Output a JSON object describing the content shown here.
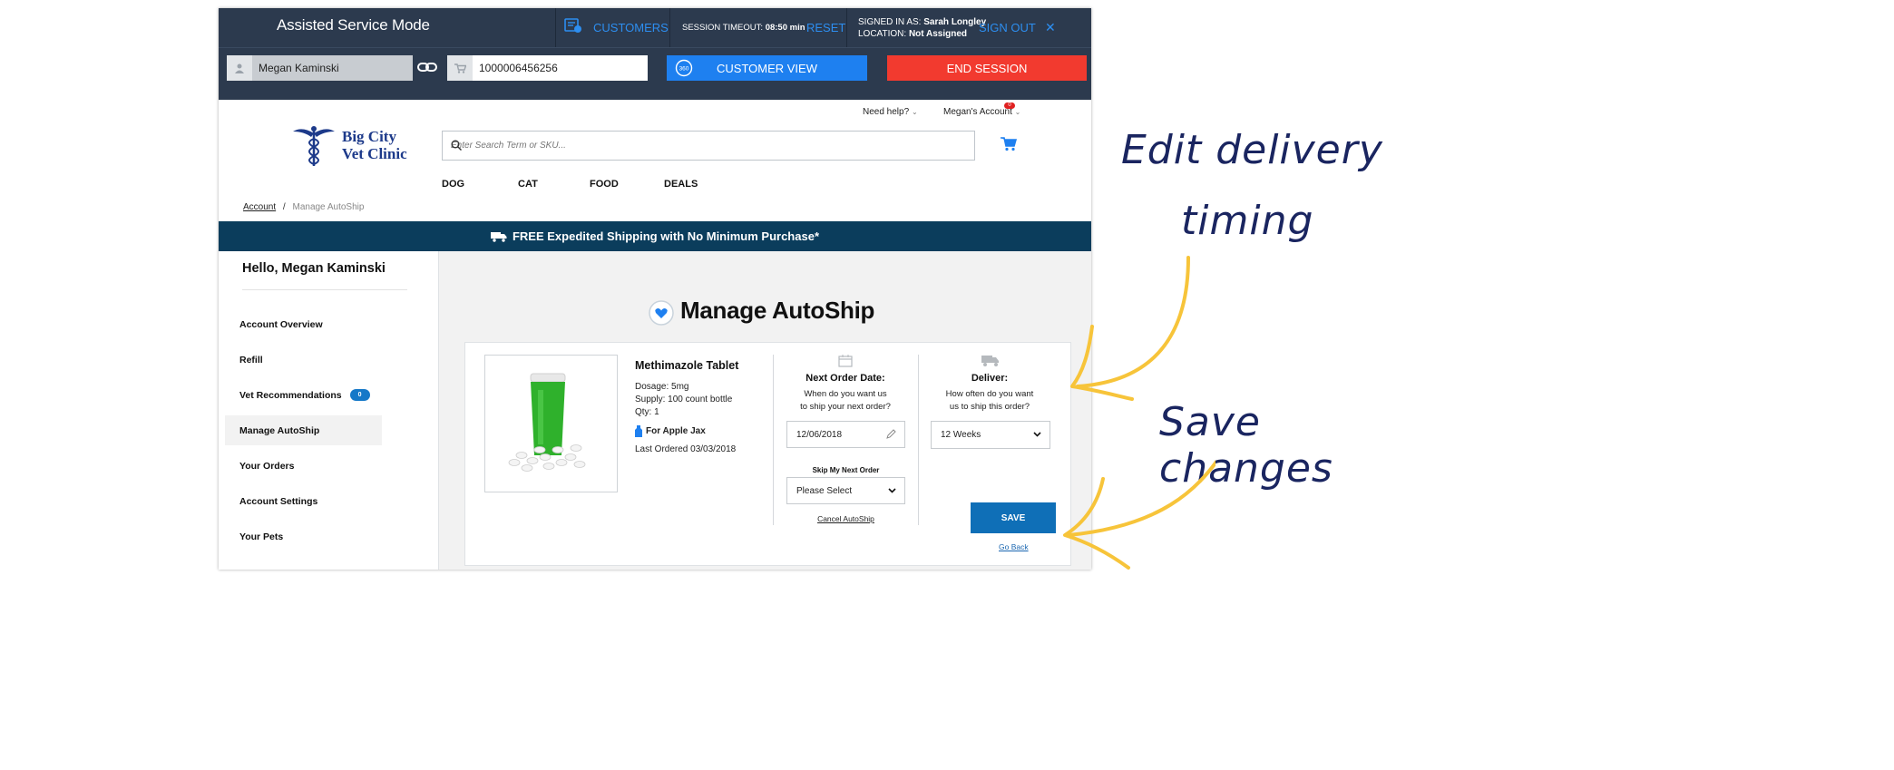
{
  "asm": {
    "title": "Assisted Service Mode",
    "customers_label": "CUSTOMERS",
    "session_timeout_label": "SESSION TIMEOUT:",
    "session_timeout_value": "08:50 min",
    "reset_label": "RESET",
    "signed_in_label": "SIGNED IN AS:",
    "signed_in_value": "Sarah Longley",
    "location_label": "LOCATION:",
    "location_value": "Not Assigned",
    "sign_out_label": "SIGN OUT",
    "close_glyph": "✕",
    "customer_name": "Megan Kaminski",
    "cart_id": "1000006456256",
    "customer_view_label": "CUSTOMER VIEW",
    "customer_view_icon_text": "360",
    "end_session_label": "END SESSION"
  },
  "header": {
    "need_help": "Need help?",
    "account_menu": "Megan's Account",
    "account_badge": "0",
    "logo_line1": "Big City",
    "logo_line2": "Vet Clinic",
    "search_placeholder": "Enter Search Term or SKU...",
    "nav": [
      "DOG",
      "CAT",
      "FOOD",
      "DEALS"
    ]
  },
  "breadcrumb": {
    "root": "Account",
    "separator": "/",
    "current": "Manage AutoShip"
  },
  "promo": {
    "text": "FREE Expedited Shipping with No Minimum Purchase*"
  },
  "sidebar": {
    "greeting": "Hello, Megan Kaminski",
    "items": [
      {
        "label": "Account Overview"
      },
      {
        "label": "Refill"
      },
      {
        "label": "Vet Recommendations",
        "badge": "0"
      },
      {
        "label": "Manage AutoShip"
      },
      {
        "label": "Your Orders"
      },
      {
        "label": "Account Settings"
      },
      {
        "label": "Your Pets"
      }
    ]
  },
  "autoship": {
    "title": "Manage AutoShip",
    "product": {
      "name": "Methimazole Tablet",
      "dosage": "Dosage: 5mg",
      "supply": "Supply:  100 count bottle",
      "qty": "Qty:  1",
      "pet": "For Apple Jax",
      "last_ordered": "Last Ordered 03/03/2018"
    },
    "next_order": {
      "title": "Next Order Date:",
      "question_line1": "When do you want us",
      "question_line2": "to ship your next order?",
      "date_value": "12/06/2018",
      "skip_label": "Skip My Next Order",
      "skip_value": "Please Select",
      "cancel_label": "Cancel AutoShip"
    },
    "deliver": {
      "title": "Deliver:",
      "question_line1": "How often do you want",
      "question_line2": "us to ship this order?",
      "frequency_value": "12 Weeks"
    },
    "save_label": "SAVE",
    "go_back_label": "Go Back"
  },
  "annotations": {
    "edit_line1": "Edit delivery",
    "edit_line2": "timing",
    "save_note": "Save changes",
    "arrow_color": "#f7c43a",
    "text_color": "#1a2560"
  },
  "colors": {
    "asm_bar": "#2c3a4e",
    "customer_view": "#1e80f0",
    "end_session": "#f23a2f",
    "promo_bar": "#0b3d5c",
    "save_button": "#0f6fb7",
    "logo": "#1d3a8a"
  }
}
